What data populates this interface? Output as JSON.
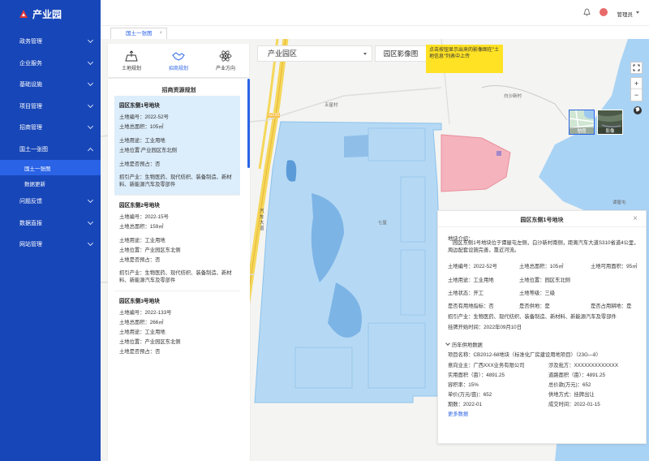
{
  "app": {
    "title": "产业园"
  },
  "sidebar": {
    "items": [
      {
        "label": "政务管理"
      },
      {
        "label": "企业服务"
      },
      {
        "label": "基础设施"
      },
      {
        "label": "项目管理"
      },
      {
        "label": "招商管理"
      },
      {
        "label": "国土一张图"
      },
      {
        "label": "问题反馈"
      },
      {
        "label": "数据直报"
      },
      {
        "label": "网站管理"
      }
    ],
    "sub_items": [
      {
        "label": "国土一张图"
      },
      {
        "label": "数据更新"
      }
    ]
  },
  "header": {
    "username": "管理员"
  },
  "tabs": [
    {
      "label": "国土一张图",
      "close": "×"
    }
  ],
  "toolbar": {
    "tools": [
      {
        "label": "土地规划"
      },
      {
        "label": "招商规划"
      },
      {
        "label": "产业方向"
      }
    ],
    "select_value": "产业园区",
    "image_button": "园区影像图",
    "tip": "点击按钮显示出来的影像图在\"土地信息\"列表中上传"
  },
  "left_panel": {
    "title": "招商资源规划",
    "cards": [
      {
        "name": "园区东侧1号地块",
        "code": "土地编号：2022-52号",
        "area": "土地总面积：105㎡",
        "use": "土地用途：工业用地",
        "location": "土地位置:产业园区东北侧",
        "pre_occupied": "土地是否预占：否",
        "industry": "招引产业：生物医药、现代纺织、装备制造、新材料、新能源汽车及零部件"
      },
      {
        "name": "园区东侧2号地块",
        "code": "土地编号：2022-15号",
        "area": "土地总面积：159㎡",
        "use": "土地用途：工业用地",
        "location": "土地位置：产业园区东北侧",
        "pre_occupied": "土地是否预占：否",
        "industry": "招引产业：生物医药、现代纺织、装备制造、新材料、新能源汽车及零部件"
      },
      {
        "name": "园区东侧3号地块",
        "code": "土地编号：2022-133号",
        "area": "土地总面积：266㎡",
        "use": "土地用途：工业用地",
        "location": "土地位置：产业园区东北侧",
        "pre_occupied": "土地是否预占：否",
        "industry": ""
      }
    ]
  },
  "map": {
    "labels": {
      "village1": "五星村",
      "village2": "七星",
      "village3": "白沙新村",
      "road": "汽车大道",
      "road_code": "G215",
      "village4": "谭屋屯"
    },
    "zoom_in": "+",
    "zoom_out": "−",
    "layers": [
      {
        "label": "地图"
      },
      {
        "label": "影像"
      }
    ]
  },
  "detail": {
    "title": "园区东侧1号地块",
    "close": "×",
    "intro_label": "地块介绍：",
    "intro": "园区东侧1号地块位于谭屋屯左侧，白沙新村南侧，距离汽车大道S310省道4公里，周边配套设施完善，靠近河流。",
    "code": "土地编号：2022-52号",
    "area": "土地总面积：105㎡",
    "usable": "土地可用面积：95㎡",
    "use": "土地用途：工业用地",
    "location": "土地位置：园区东北侧",
    "status": "土地状态：开工",
    "grade": "土地等级：三级",
    "indicator": "是否有用地指标：否",
    "supplied": "是否供地：是",
    "cultivated": "是否占用耕地：是",
    "industry": "招引产业：生物医药、现代纺织、装备制造、新材料、新能源汽车及零部件",
    "listing_date": "挂牌开始时间：2022年09月10日",
    "history_label": "历年供地数据",
    "project": "项目名称：CB2012-68地块（标准化厂房建设用地项目）（23G—8）",
    "unit": "意向业主：广西XXX业务有限公司",
    "approval": "涉及批方：XXXXXXXXXXXXX",
    "actual_area": "实用面积（亩）：4891.25",
    "road_area": "道路面积（亩）：4891.25",
    "plot_ratio": "容积率：15%",
    "total_price": "总价款(万元)：652",
    "unit_price": "单价(万元/亩)：652",
    "supply_method": "供地方式：挂牌出让",
    "period": "期数：2022-01",
    "deal_date": "成交时间：2022-01-15",
    "more": "更多数据"
  }
}
